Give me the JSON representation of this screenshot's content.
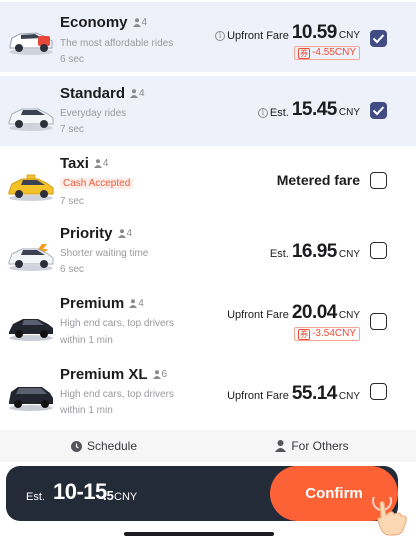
{
  "rides": [
    {
      "name": "Economy",
      "seats": "4",
      "subtitle": "The most affordable rides",
      "eta": "6 sec",
      "price_prefix": "Upfront Fare",
      "price": "10.59",
      "currency": "CNY",
      "discount": "-4.55CNY",
      "selected": true
    },
    {
      "name": "Standard",
      "seats": "4",
      "subtitle": "Everyday rides",
      "eta": "7 sec",
      "price_prefix": "Est.",
      "price": "15.45",
      "currency": "CNY",
      "selected": true
    },
    {
      "name": "Taxi",
      "seats": "4",
      "tag": "Cash Accepted",
      "eta": "7 sec",
      "fare_text": "Metered fare",
      "selected": false
    },
    {
      "name": "Priority",
      "seats": "4",
      "subtitle": "Shorter waiting time",
      "eta": "6 sec",
      "price_prefix": "Est.",
      "price": "16.95",
      "currency": "CNY",
      "selected": false
    },
    {
      "name": "Premium",
      "seats": "4",
      "subtitle": "High end cars, top drivers",
      "eta": "within 1 min",
      "price_prefix": "Upfront Fare",
      "price": "20.04",
      "currency": "CNY",
      "discount": "-3.54CNY",
      "selected": false
    },
    {
      "name": "Premium XL",
      "seats": "6",
      "subtitle": "High end cars, top drivers",
      "eta": "within 1 min",
      "price_prefix": "Upfront Fare",
      "price": "55.14",
      "currency": "CNY",
      "selected": false
    }
  ],
  "footer": {
    "schedule": "Schedule",
    "for_others": "For Others"
  },
  "summary": {
    "est_label": "Est.",
    "range": "10-15",
    "decimal": ".5",
    "currency": "CNY",
    "confirm": "Confirm"
  },
  "colors": {
    "accent": "#fd6136",
    "checkbox": "#414c84",
    "bar": "#232a38",
    "discount": "#ef4b33"
  }
}
